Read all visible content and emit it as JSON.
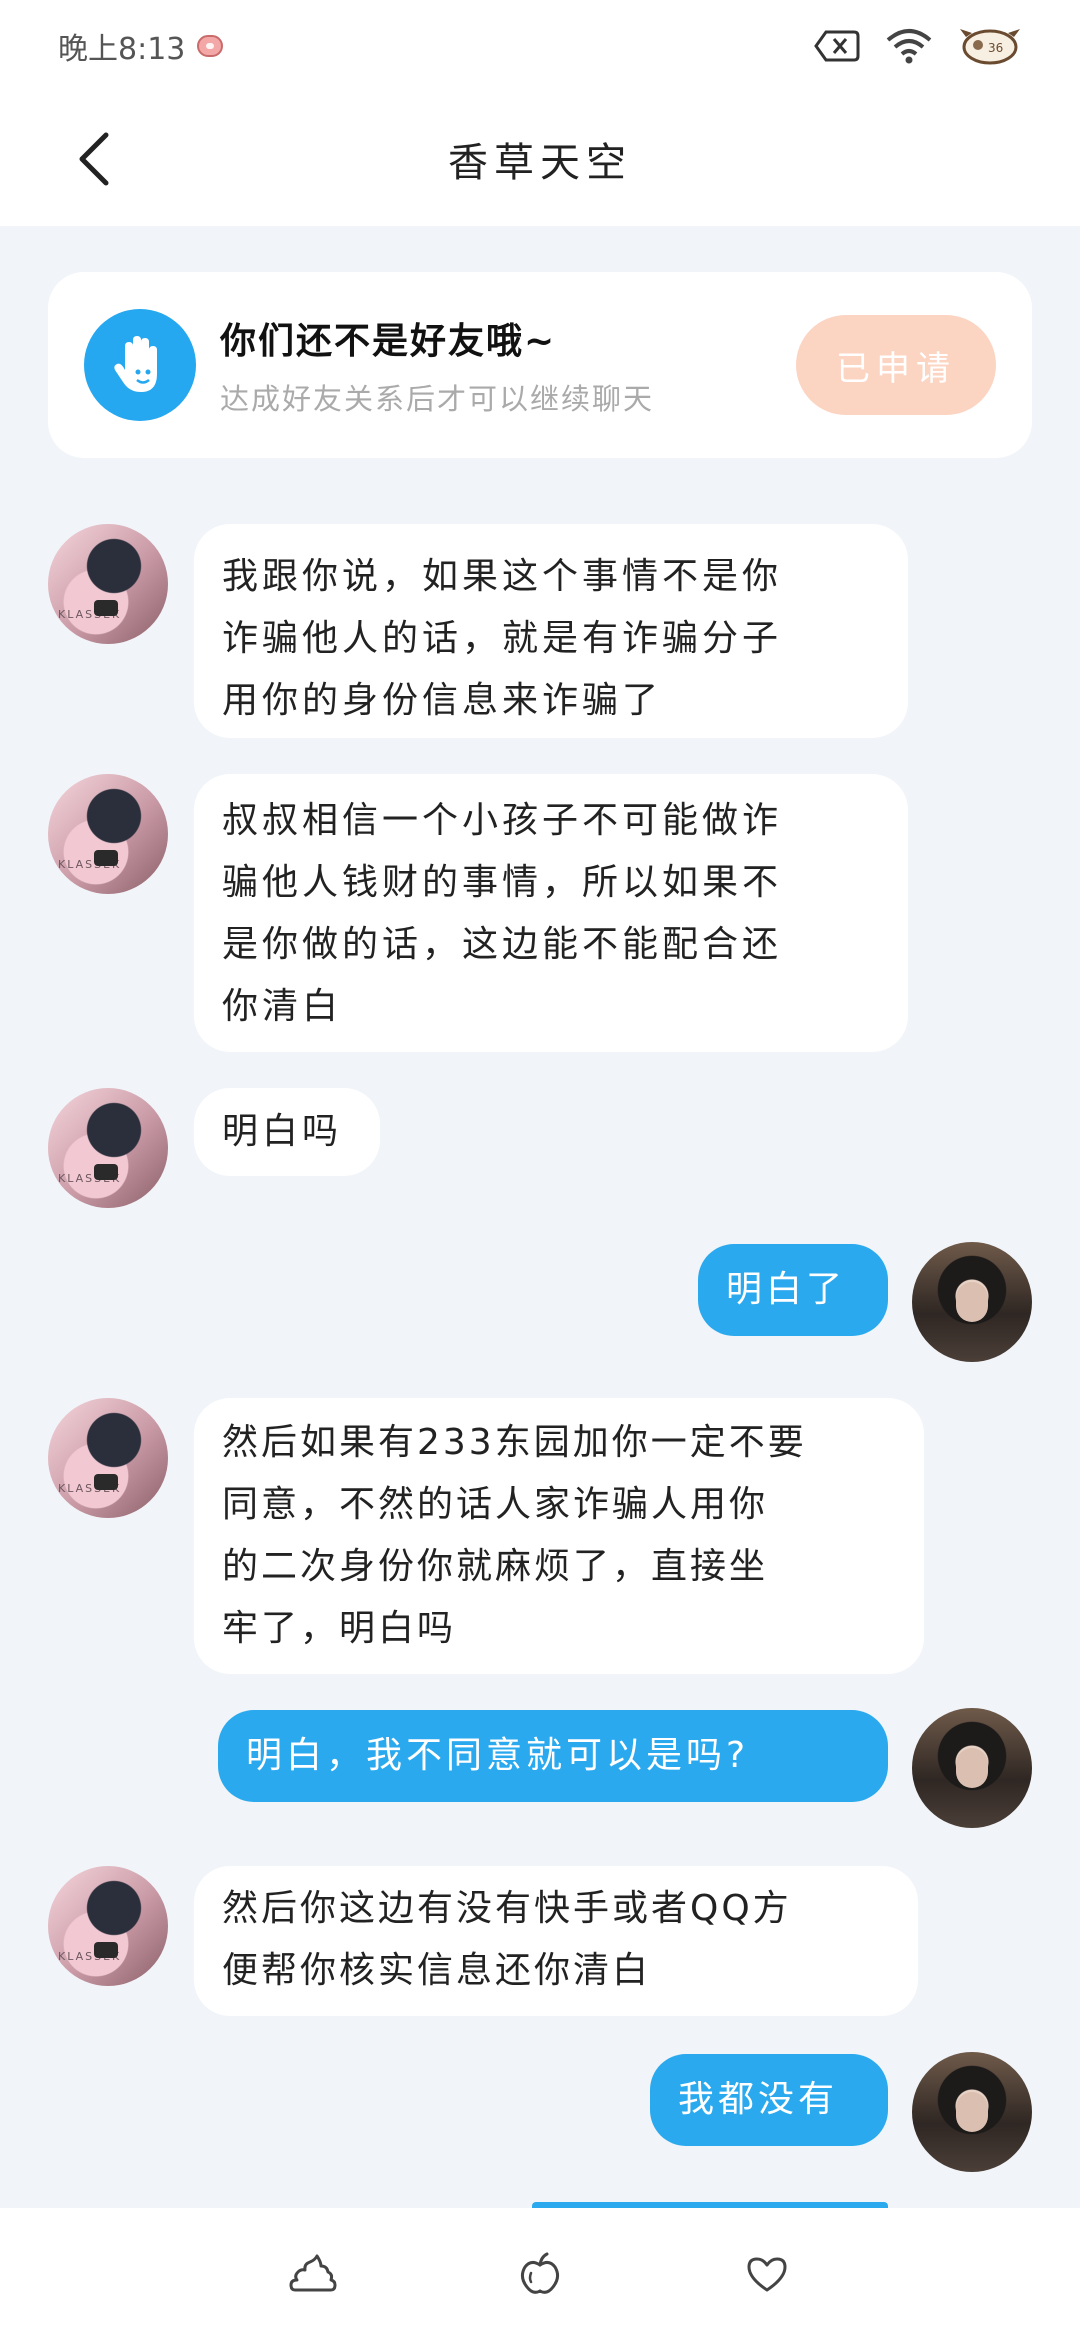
{
  "status_bar": {
    "time": "晚上8:13"
  },
  "header": {
    "title": "香草天空"
  },
  "friend_card": {
    "title": "你们还不是好友哦~",
    "subtitle": "达成好友关系后才可以继续聊天",
    "button_label": "已申请"
  },
  "messages": [
    {
      "side": "left",
      "text": "我跟你说，如果这个事情不是你\n诈骗他人的话，就是有诈骗分子\n用你的身份信息来诈骗了"
    },
    {
      "side": "left",
      "text": "叔叔相信一个小孩子不可能做诈\n骗他人钱财的事情，所以如果不\n是你做的话，这边能不能配合还\n你清白"
    },
    {
      "side": "left",
      "text": "明白吗"
    },
    {
      "side": "right",
      "text": "明白了"
    },
    {
      "side": "left",
      "text": "然后如果有233东园加你一定不要\n同意，不然的话人家诈骗人用你\n的二次身份你就麻烦了，直接坐\n牢了，明白吗"
    },
    {
      "side": "right",
      "text": "明白，我不同意就可以是吗?"
    },
    {
      "side": "left",
      "text": "然后你这边有没有快手或者QQ方\n便帮你核实信息还你清白"
    },
    {
      "side": "right",
      "text": "我都没有"
    }
  ],
  "avatar_watermark": "KLASSEK",
  "bottom_nav": {
    "icons": [
      "poop-icon",
      "apple-icon",
      "heart-icon"
    ]
  }
}
